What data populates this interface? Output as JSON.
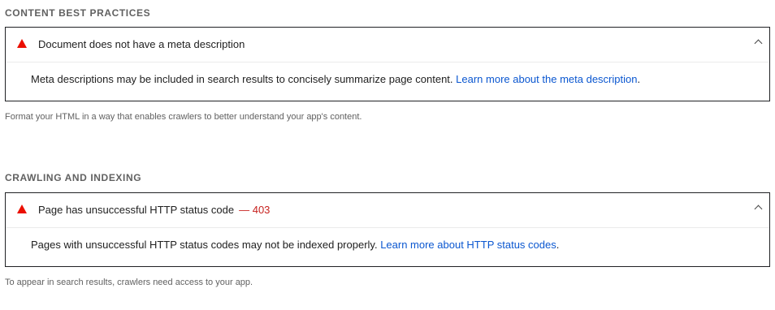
{
  "sections": [
    {
      "title": "CONTENT BEST PRACTICES",
      "audit": {
        "title": "Document does not have a meta description",
        "display_value": "",
        "description": "Meta descriptions may be included in search results to concisely summarize page content. ",
        "link_text": "Learn more about the meta description",
        "description_end": "."
      },
      "group_description": "Format your HTML in a way that enables crawlers to better understand your app's content."
    },
    {
      "title": "CRAWLING AND INDEXING",
      "audit": {
        "title": "Page has unsuccessful HTTP status code",
        "display_value": "— 403",
        "description": "Pages with unsuccessful HTTP status codes may not be indexed properly. ",
        "link_text": "Learn more about HTTP status codes",
        "description_end": "."
      },
      "group_description": "To appear in search results, crawlers need access to your app."
    }
  ],
  "colors": {
    "fail": "#eb0f00",
    "link": "#0b57d0",
    "display_value": "#c7221f"
  }
}
